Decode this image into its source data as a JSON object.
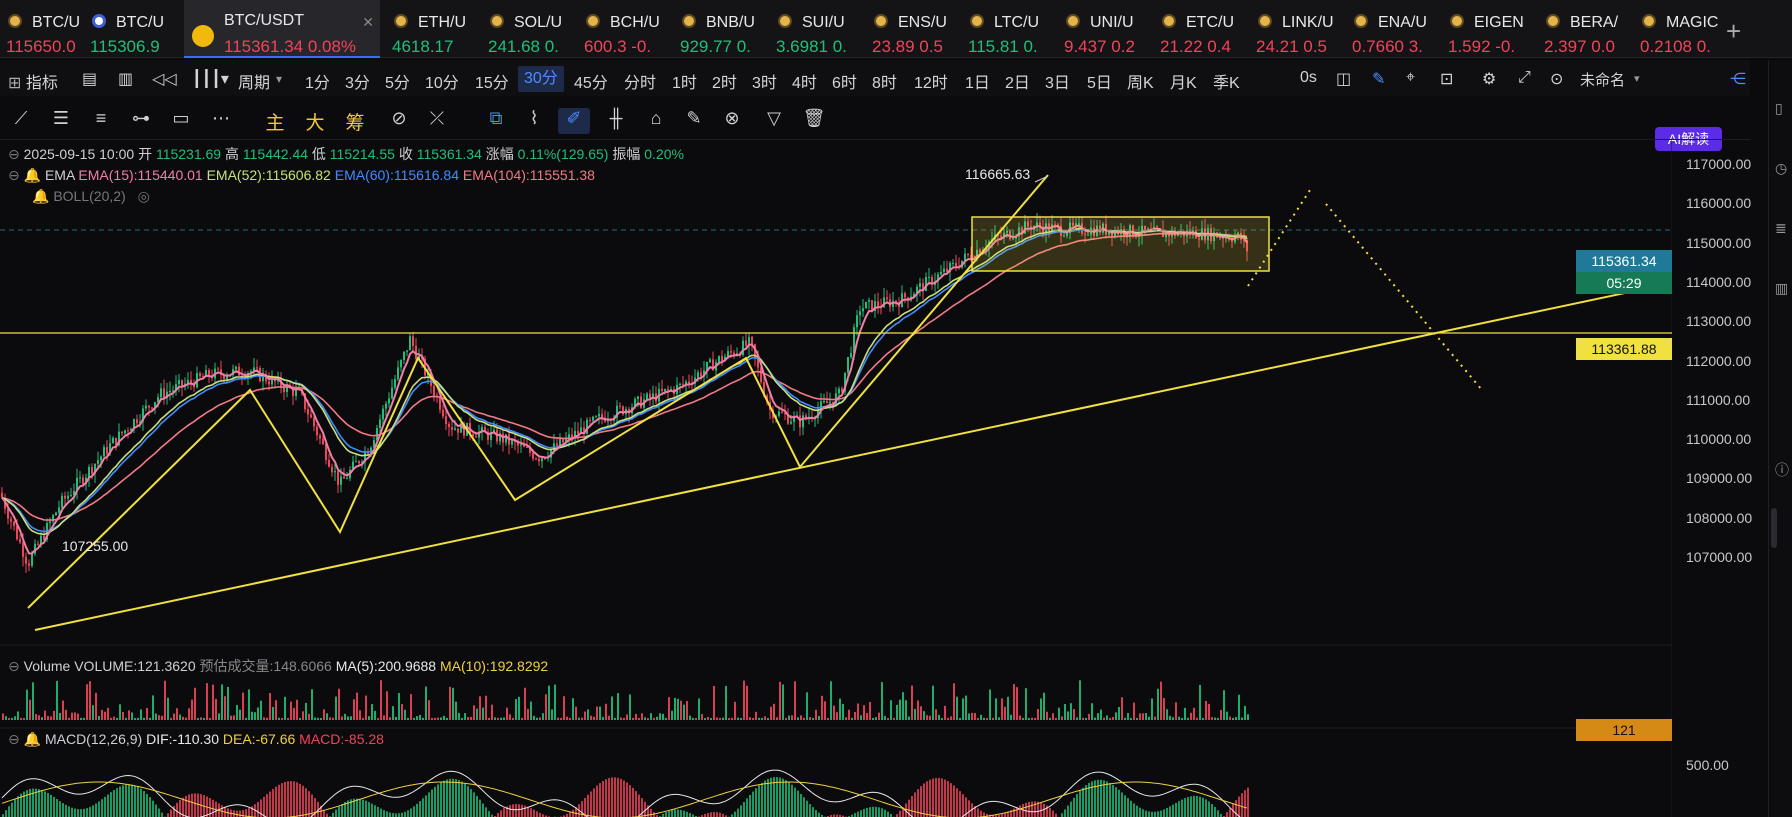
{
  "tabs": [
    {
      "sym": "BTC/U",
      "price": "115650.0",
      "color": "red",
      "icon": "coin-icon"
    },
    {
      "sym": "BTC/U",
      "price": "115306.9",
      "color": "green",
      "icon": "coin-icon"
    },
    {
      "sym": "BTC/USDT",
      "price": "115361.34 0.08%",
      "color": "red",
      "icon": "bnb-icon",
      "active": true
    },
    {
      "sym": "ETH/U",
      "price": "4618.17",
      "color": "green",
      "icon": "coin-icon"
    },
    {
      "sym": "SOL/U",
      "price": "241.68 0.",
      "color": "green",
      "icon": "coin-icon"
    },
    {
      "sym": "BCH/U",
      "price": "600.3 -0.",
      "color": "red",
      "icon": "coin-icon"
    },
    {
      "sym": "BNB/U",
      "price": "929.77 0.",
      "color": "green",
      "icon": "coin-icon"
    },
    {
      "sym": "SUI/U",
      "price": "3.6981 0.",
      "color": "green",
      "icon": "coin-icon"
    },
    {
      "sym": "ENS/U",
      "price": "23.89 0.5",
      "color": "red",
      "icon": "coin-icon"
    },
    {
      "sym": "LTC/U",
      "price": "115.81 0.",
      "color": "green",
      "icon": "coin-icon"
    },
    {
      "sym": "UNI/U",
      "price": "9.437 0.2",
      "color": "red",
      "icon": "coin-icon"
    },
    {
      "sym": "ETC/U",
      "price": "21.22 0.4",
      "color": "red",
      "icon": "coin-icon"
    },
    {
      "sym": "LINK/U",
      "price": "24.21 0.5",
      "color": "red",
      "icon": "coin-icon"
    },
    {
      "sym": "ENA/U",
      "price": "0.7660 3.",
      "color": "red",
      "icon": "coin-icon"
    },
    {
      "sym": "EIGEN",
      "price": "1.592 -0.",
      "color": "red",
      "icon": "coin-icon"
    },
    {
      "sym": "BERA/",
      "price": "2.397 0.0",
      "color": "red",
      "icon": "coin-icon"
    },
    {
      "sym": "MAGIC",
      "price": "0.2108 0.",
      "color": "red",
      "icon": "coin-icon"
    }
  ],
  "add_tab": "+",
  "toolbar": {
    "indicator": "指标",
    "period": "周期",
    "intervals": [
      "1分",
      "3分",
      "5分",
      "10分",
      "15分",
      "30分",
      "45分",
      "分时",
      "1时",
      "2时",
      "3时",
      "4时",
      "6时",
      "8时",
      "12时",
      "1日",
      "2日",
      "3日",
      "5日",
      "周K",
      "月K",
      "季K"
    ],
    "selected_interval": "30分",
    "replay": "0s",
    "layout_name": "未命名",
    "ai_button": "AI解读"
  },
  "drawtools": [
    "主",
    "大",
    "筹"
  ],
  "ohlc": {
    "date": "2025-09-15 10:00",
    "open_l": "开",
    "open": "115231.69",
    "high_l": "高",
    "high": "115442.44",
    "low_l": "低",
    "low": "115214.55",
    "close_l": "收",
    "close": "115361.34",
    "chg_l": "涨幅",
    "chg": "0.11%(129.65)",
    "amp_l": "振幅",
    "amp": "0.20%"
  },
  "ema": {
    "name": "EMA",
    "e15": "EMA(15):115440.01",
    "e52": "EMA(52):115606.82",
    "e60": "EMA(60):115616.84",
    "e104": "EMA(104):115551.38"
  },
  "boll": "BOLL(20,2)",
  "volume": {
    "name": "Volume",
    "v": "VOLUME:121.3620",
    "est": "预估成交量:148.6066",
    "ma5": "MA(5):200.9688",
    "ma10": "MA(10):192.8292",
    "last": "121"
  },
  "macd": {
    "name": "MACD(12,26,9)",
    "dif": "DIF:-110.30",
    "dea": "DEA:-67.66",
    "macd": "MACD:-85.28",
    "tick": "500.00"
  },
  "price_axis": [
    "117000.00",
    "116000.00",
    "115000.00",
    "114000.00",
    "113000.00",
    "112000.00",
    "111000.00",
    "110000.00",
    "109000.00",
    "108000.00",
    "107000.00"
  ],
  "labels": {
    "current": "115361.34",
    "countdown": "05:29",
    "hline": "113361.88",
    "high_mark": "116665.63",
    "low_mark": "107255.00"
  },
  "colors": {
    "up": "#1fbf7a",
    "down": "#f0445a",
    "ema15": "#f07fa8",
    "ema52": "#c8e07a",
    "ema60": "#3f8cff",
    "ema104": "#f07a86",
    "draw": "#f0e040"
  }
}
